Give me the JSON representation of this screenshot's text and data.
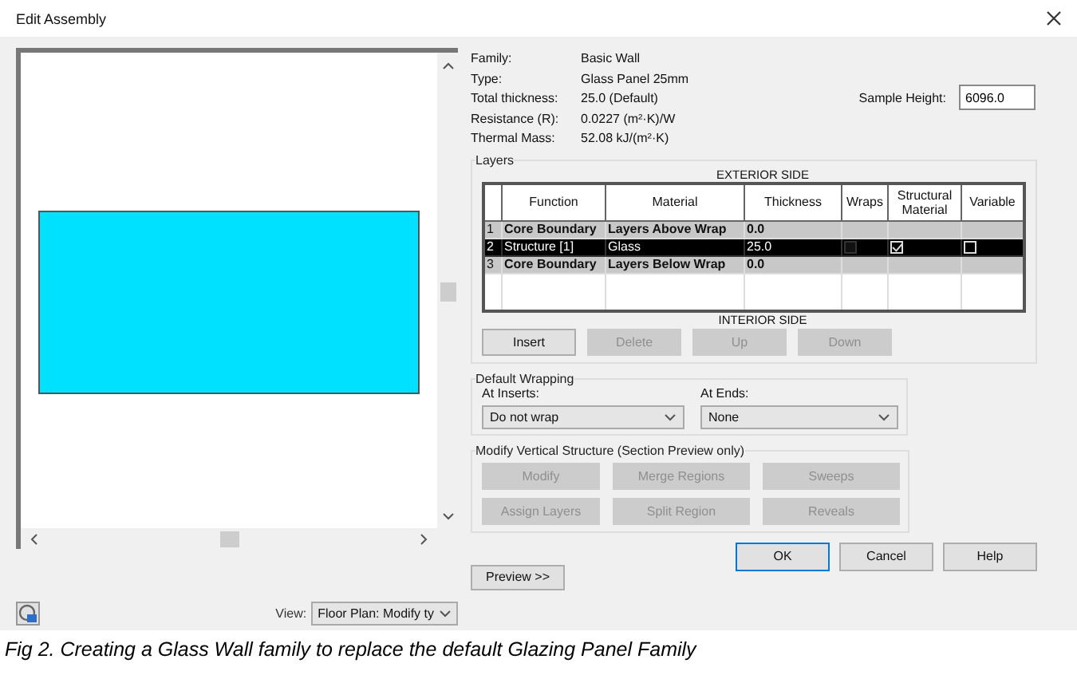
{
  "window": {
    "title": "Edit Assembly"
  },
  "preview": {
    "view_label": "View:",
    "view_value": "Floor Plan: Modify ty",
    "button": "Preview >>"
  },
  "properties": [
    {
      "label": "Family:",
      "value": "Basic Wall"
    },
    {
      "label": "Type:",
      "value": "Glass Panel 25mm"
    },
    {
      "label": "Total thickness:",
      "value": "25.0 (Default)"
    },
    {
      "label": "Resistance (R):",
      "value": "0.0227 (m²·K)/W"
    },
    {
      "label": "Thermal Mass:",
      "value": "52.08 kJ/(m²·K)"
    }
  ],
  "sample_height": {
    "label": "Sample Height:",
    "value": "6096.0"
  },
  "layers": {
    "title": "Layers",
    "exterior_label": "EXTERIOR SIDE",
    "interior_label": "INTERIOR SIDE",
    "columns": [
      "Function",
      "Material",
      "Thickness",
      "Wraps",
      "Structural Material",
      "Variable"
    ],
    "rows": [
      {
        "number": "1",
        "kind": "boundary",
        "function": "Core Boundary",
        "material": "Layers Above Wrap",
        "thickness": "0.0",
        "selected": false
      },
      {
        "number": "2",
        "kind": "layer",
        "function": "Structure [1]",
        "material": "Glass",
        "thickness": "25.0",
        "wraps": false,
        "structural_material": true,
        "variable": false,
        "selected": true
      },
      {
        "number": "3",
        "kind": "boundary",
        "function": "Core Boundary",
        "material": "Layers Below Wrap",
        "thickness": "0.0",
        "selected": false
      }
    ],
    "buttons": [
      {
        "label": "Insert",
        "disabled": false
      },
      {
        "label": "Delete",
        "disabled": true
      },
      {
        "label": "Up",
        "disabled": true
      },
      {
        "label": "Down",
        "disabled": true
      }
    ]
  },
  "default_wrapping": {
    "title": "Default Wrapping",
    "at_inserts": {
      "label": "At Inserts:",
      "value": "Do not wrap"
    },
    "at_ends": {
      "label": "At  Ends:",
      "value": "None"
    }
  },
  "modify_vertical_structure": {
    "title": "Modify Vertical Structure (Section Preview only)",
    "buttons": [
      {
        "label": "Modify",
        "disabled": true
      },
      {
        "label": "Merge Regions",
        "disabled": true
      },
      {
        "label": "Sweeps",
        "disabled": true
      },
      {
        "label": "Assign Layers",
        "disabled": true
      },
      {
        "label": "Split Region",
        "disabled": true
      },
      {
        "label": "Reveals",
        "disabled": true
      }
    ]
  },
  "dialog_buttons": [
    {
      "label": "OK",
      "default": true
    },
    {
      "label": "Cancel",
      "default": false
    },
    {
      "label": "Help",
      "default": false
    }
  ],
  "caption": "Fig 2. Creating a Glass Wall family to replace the default Glazing Panel Family"
}
